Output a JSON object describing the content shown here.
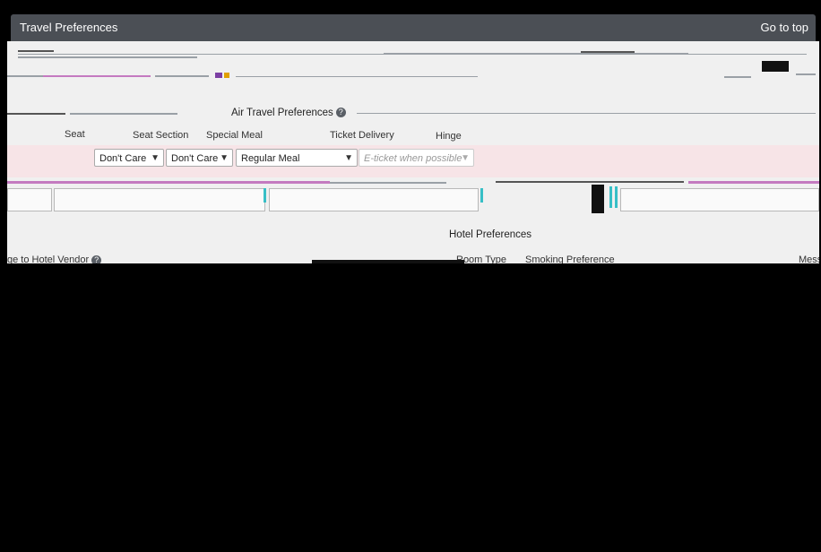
{
  "header": {
    "title": "Travel Preferences",
    "go_to_top": "Go to top"
  },
  "air": {
    "section_title": "Air Travel Preferences",
    "help_glyph": "?",
    "columns": {
      "seat": "Seat",
      "seat_section": "Seat Section",
      "special_meal": "Special Meal",
      "ticket_delivery": "Ticket Delivery",
      "hint": "Hinge"
    },
    "selects": {
      "seat": "Don't Care",
      "seat_section": "Don't Care",
      "special_meal": "Regular Meal",
      "ticket_delivery": "E-ticket when possible"
    }
  },
  "hotel": {
    "section_title": "Hotel Preferences",
    "message_to_vendor": "ge to Hotel Vendor",
    "room_type": "Room Type",
    "smoking_preference": "Smoking Preference",
    "message_truncated": "Mess"
  },
  "icons": {
    "help": "help-icon",
    "chevron": "chevron-down-icon"
  },
  "colors": {
    "header_bg": "#4b4f55",
    "panel_bg": "#f0f0f0",
    "pink_band": "#f7e4e7",
    "accent_teal": "#37bfc6"
  }
}
